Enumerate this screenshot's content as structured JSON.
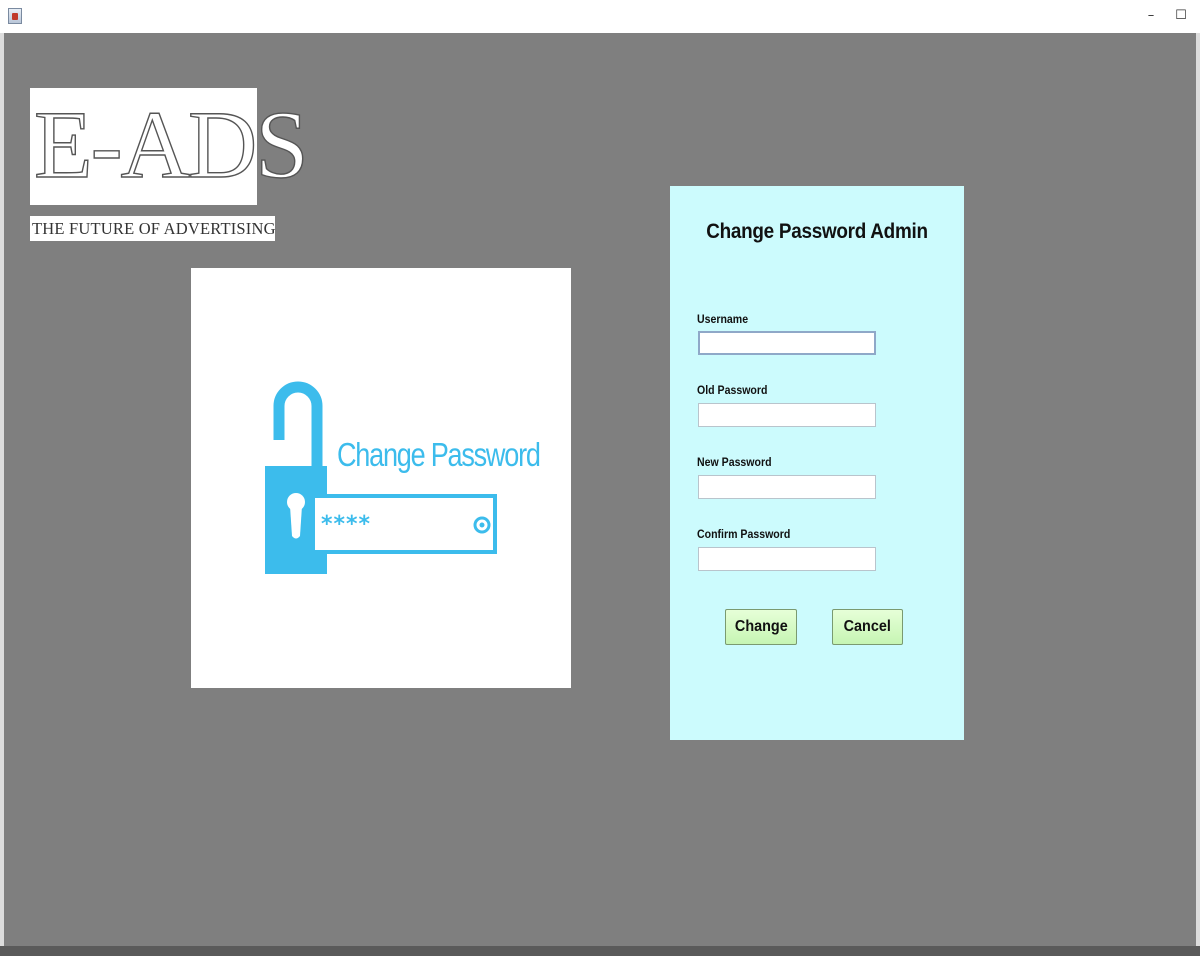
{
  "window": {
    "app_icon": "java-cup-icon",
    "minimize_glyph": "–",
    "maximize_glyph": "☐"
  },
  "logo": {
    "title": "E-ADS",
    "tagline": "THE FUTURE OF ADVERTISING"
  },
  "illustration": {
    "label": "Change Password",
    "masked_text": "****",
    "accent_color": "#3cbcec",
    "icons": [
      "padlock-icon",
      "eye-icon"
    ]
  },
  "form": {
    "title": "Change Password Admin",
    "background_color": "#ccfbfd",
    "fields": [
      {
        "label": "Username",
        "value": ""
      },
      {
        "label": "Old Password",
        "value": ""
      },
      {
        "label": "New Password",
        "value": ""
      },
      {
        "label": "Confirm Password",
        "value": ""
      }
    ],
    "buttons": {
      "change": "Change",
      "cancel": "Cancel"
    }
  },
  "colors": {
    "background": "#7f7f7f",
    "button": "#d4f8c4"
  }
}
